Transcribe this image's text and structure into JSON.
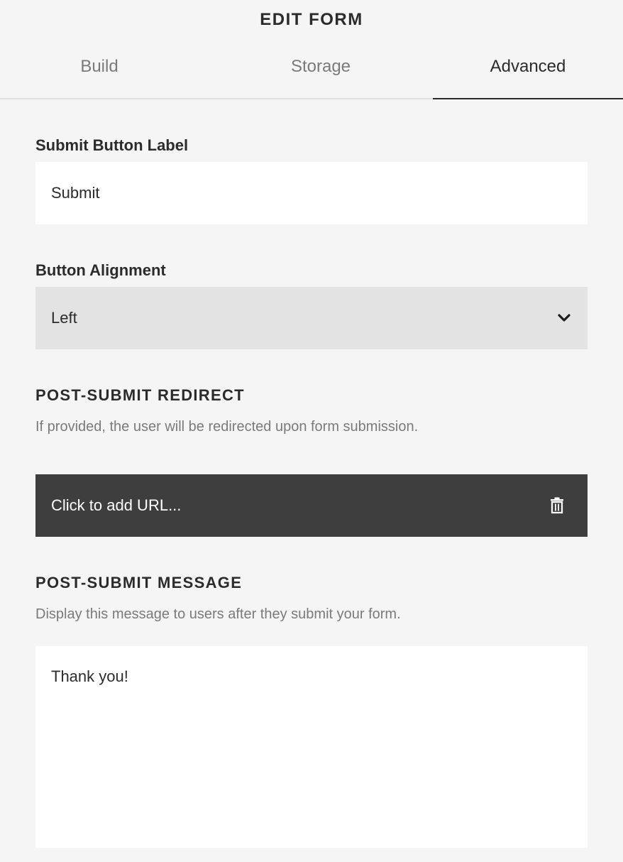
{
  "header": {
    "title": "EDIT FORM"
  },
  "tabs": [
    {
      "label": "Build",
      "active": false
    },
    {
      "label": "Storage",
      "active": false
    },
    {
      "label": "Advanced",
      "active": true
    }
  ],
  "submit_button_label": {
    "label": "Submit Button Label",
    "value": "Submit"
  },
  "button_alignment": {
    "label": "Button Alignment",
    "selected": "Left",
    "icon": "chevron-down-icon"
  },
  "post_submit_redirect": {
    "heading": "POST-SUBMIT REDIRECT",
    "description": "If provided, the user will be redirected upon form submission.",
    "url_placeholder": "Click to add URL...",
    "icon": "trash-icon"
  },
  "post_submit_message": {
    "heading": "POST-SUBMIT MESSAGE",
    "description": "Display this message to users after they submit your form.",
    "value": "Thank you!"
  },
  "colors": {
    "background": "#f5f5f5",
    "text": "#2b2b2b",
    "muted": "#7a7a7a",
    "select_bg": "#e3e3e3",
    "url_bar_bg": "#3e3e3e"
  }
}
